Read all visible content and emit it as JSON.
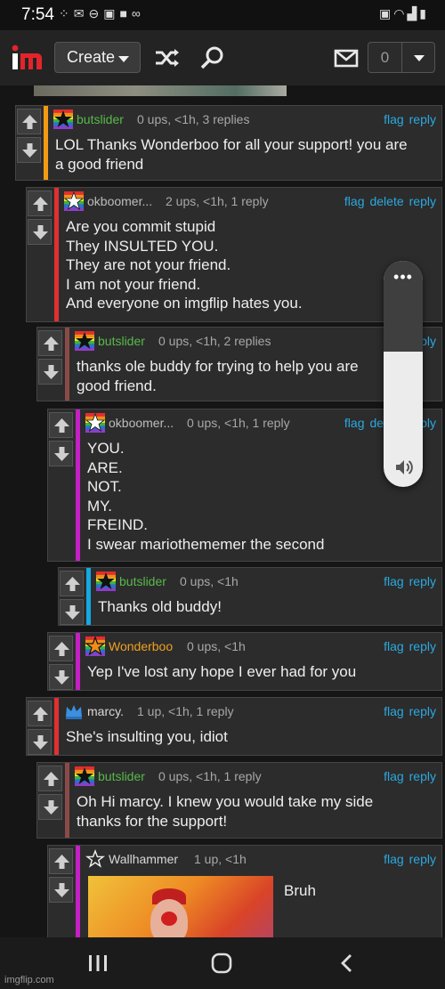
{
  "status_bar": {
    "time": "7:54",
    "left_icons": [
      "notification-dots-icon",
      "tool-icon",
      "dnd-icon",
      "gallery-icon",
      "square-icon",
      "voicemail-icon"
    ],
    "right_icons": [
      "save-icon",
      "wifi-icon",
      "signal-icon",
      "battery-icon"
    ]
  },
  "header": {
    "logo": "im",
    "create_label": "Create",
    "notification_count": "0"
  },
  "colors": {
    "page_bg": "#151515",
    "panel_bg": "#2c2c2c",
    "link_blue": "#2aa9e0",
    "username_green": "#58b94a",
    "meta_gray": "#a8a8a8"
  },
  "comments": [
    {
      "username": "butslider",
      "meta": "0 ups, <1h, 3 replies",
      "actions": [
        "flag",
        "reply"
      ],
      "text": "LOL Thanks Wonderboo for all your support! you are\na good friend",
      "bar_color": "#f39a13",
      "avatar": "rainbow-star"
    },
    {
      "username": "okboomer...",
      "meta": "2 ups, <1h, 1 reply",
      "actions": [
        "flag",
        "delete",
        "reply"
      ],
      "text": "Are you commit stupid\nThey INSULTED YOU.\nThey are not your friend.\nI am not your friend.\nAnd everyone on imgflip hates you.",
      "bar_color": "#e03030",
      "avatar": "rainbow-white-star"
    },
    {
      "username": "butslider",
      "meta": "0 ups, <1h, 2 replies",
      "actions": [
        "flag",
        "reply"
      ],
      "text": "thanks ole buddy for trying to help you are\ngood friend.",
      "bar_color": "#8b4a4a",
      "avatar": "rainbow-star"
    },
    {
      "username": "okboomer...",
      "meta": "0 ups, <1h, 1 reply",
      "actions": [
        "flag",
        "delete",
        "reply"
      ],
      "text": "YOU.\nARE.\nNOT.\nMY.\nFREIND.\nI swear mariothememer the second",
      "bar_color": "#c420c4",
      "avatar": "rainbow-white-star"
    },
    {
      "username": "butslider",
      "meta": "0 ups, <1h",
      "actions": [
        "flag",
        "reply"
      ],
      "text": "Thanks old buddy!",
      "bar_color": "#14a9e2",
      "avatar": "rainbow-star"
    },
    {
      "username": "Wonderboo",
      "meta": "0 ups, <1h",
      "actions": [
        "flag",
        "reply"
      ],
      "text": "Yep I've lost any hope I ever had for you",
      "bar_color": "#c420c4",
      "avatar": "rainbow-orange-star"
    },
    {
      "username": "marcy.",
      "meta": "1 up, <1h, 1 reply",
      "actions": [
        "flag",
        "reply"
      ],
      "text": "She's insulting you, idiot",
      "bar_color": "#e03030",
      "avatar": "blue-crown"
    },
    {
      "username": "butslider",
      "meta": "0 ups, <1h, 1 reply",
      "actions": [
        "flag",
        "reply"
      ],
      "text": "Oh Hi marcy. I knew you would take my side\nthanks for the support!",
      "bar_color": "#8b4a4a",
      "avatar": "rainbow-star"
    },
    {
      "username": "Wallhammer",
      "meta": "1 up, <1h",
      "actions": [
        "flag",
        "reply"
      ],
      "text": "Bruh",
      "bar_color": "#c420c4",
      "avatar": "outline-star",
      "has_image": true
    }
  ],
  "volume_panel": {
    "more_icon": "more-dots-icon",
    "speaker_icon": "speaker-icon",
    "level": 0.6
  },
  "nav_bar": {
    "buttons": [
      "recent-apps-icon",
      "home-icon",
      "back-icon"
    ],
    "watermark": "imgflip.com"
  }
}
